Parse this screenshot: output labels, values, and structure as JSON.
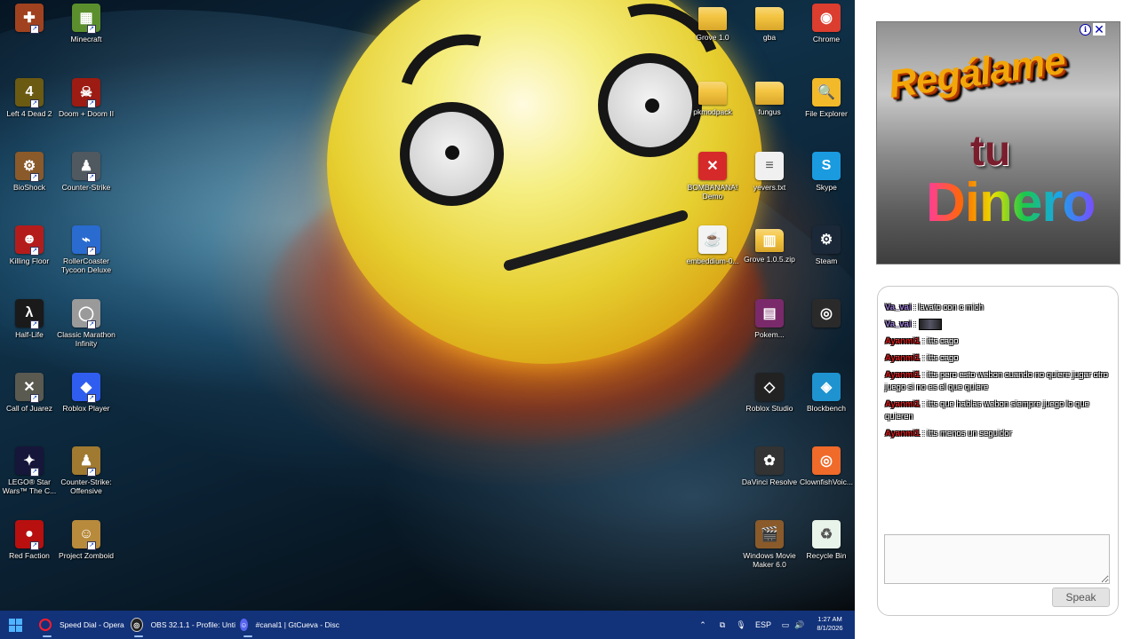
{
  "desktop": {
    "icons": [
      {
        "name": "Team Fortress",
        "label": "",
        "icon": "tf-icon",
        "color": "#a0421f",
        "glyph": "✚"
      },
      {
        "name": "Minecraft",
        "label": "Minecraft",
        "icon": "minecraft-icon",
        "color": "#5b8f2d",
        "glyph": "▦"
      },
      {
        "name": "Left 4 Dead 2",
        "label": "Left 4 Dead 2",
        "icon": "left4dead-icon",
        "color": "#6b5a12",
        "glyph": "4"
      },
      {
        "name": "Doom",
        "label": "Doom + Doom II",
        "icon": "doom-icon",
        "color": "#9c1b12",
        "glyph": "☠"
      },
      {
        "name": "BioShock",
        "label": "BioShock",
        "icon": "bioshock-icon",
        "color": "#8a5a2a",
        "glyph": "⚙"
      },
      {
        "name": "Counter-Strike",
        "label": "Counter-Strike",
        "icon": "counterstrike-icon",
        "color": "#505860",
        "glyph": "♟"
      },
      {
        "name": "Killing Floor",
        "label": "Killing Floor",
        "icon": "killingfloor-icon",
        "color": "#b41c1c",
        "glyph": "☻"
      },
      {
        "name": "RollerCoaster Tycoon Deluxe",
        "label": "RollerCoaster Tycoon Deluxe",
        "icon": "rollercoaster-icon",
        "color": "#2a6bd0",
        "glyph": "⌁"
      },
      {
        "name": "Half-Life",
        "label": "Half-Life",
        "icon": "halflife-icon",
        "color": "#1a1a1a",
        "glyph": "λ"
      },
      {
        "name": "Classic Marathon Infinity",
        "label": "Classic Marathon Infinity",
        "icon": "marathon-icon",
        "color": "#9a9a9a",
        "glyph": "◯"
      },
      {
        "name": "Call of Juarez",
        "label": "Call of Juarez",
        "icon": "callofjuarez-icon",
        "color": "#5a5a50",
        "glyph": "✕"
      },
      {
        "name": "Roblox Player",
        "label": "Roblox Player",
        "icon": "roblox-icon",
        "color": "#2f5df0",
        "glyph": "◆"
      },
      {
        "name": "LEGO Star Wars",
        "label": "LEGO® Star Wars™ The C...",
        "icon": "legostarwars-icon",
        "color": "#16163a",
        "glyph": "✦"
      },
      {
        "name": "Counter-Strike Offensive",
        "label": "Counter-Strike: Offensive",
        "icon": "csgo-icon",
        "color": "#a07a30",
        "glyph": "♟"
      },
      {
        "name": "Red Faction",
        "label": "Red Faction",
        "icon": "redfaction-icon",
        "color": "#b80f0f",
        "glyph": "●"
      },
      {
        "name": "Project Zomboid",
        "label": "Project Zomboid",
        "icon": "projectzomboid-icon",
        "color": "#b88a3c",
        "glyph": "☺"
      },
      {
        "name": "Grove Folder",
        "label": "Grove 1.0",
        "icon": "folder-icon",
        "color": "#f4c542",
        "glyph": ""
      },
      {
        "name": "gba",
        "label": "gba",
        "icon": "folder-icon",
        "color": "#f4c542",
        "glyph": ""
      },
      {
        "name": "Chrome",
        "label": "Chrome",
        "icon": "chrome-icon",
        "color": "#db3d2e",
        "glyph": "◉"
      },
      {
        "name": "pkmodpack",
        "label": "pkmodpack",
        "icon": "folder-icon",
        "color": "#f4c542",
        "glyph": ""
      },
      {
        "name": "fungus",
        "label": "fungus",
        "icon": "folder-icon",
        "color": "#f4c542",
        "glyph": ""
      },
      {
        "name": "File Explorer",
        "label": "File Explorer",
        "icon": "file-explorer-icon",
        "color": "#f2b92a",
        "glyph": "🔍"
      },
      {
        "name": "BOMBANANA",
        "label": "BOMBANANA! Demo",
        "icon": "bombanana-icon",
        "color": "#d62a2a",
        "glyph": "✕"
      },
      {
        "name": "yevers",
        "label": "yevers.txt",
        "icon": "text-file-icon",
        "color": "#f0f0f0",
        "glyph": "≡"
      },
      {
        "name": "Skype",
        "label": "Skype",
        "icon": "skype-icon",
        "color": "#1a9be0",
        "glyph": "S"
      },
      {
        "name": "embeddium",
        "label": "embeddium-0...",
        "icon": "java-icon",
        "color": "#f3f3f3",
        "glyph": "☕"
      },
      {
        "name": "Grove zip",
        "label": "Grove 1.0.5.zip",
        "icon": "zip-icon",
        "color": "#f4c542",
        "glyph": "▥"
      },
      {
        "name": "Steam",
        "label": "Steam",
        "icon": "steam-icon",
        "color": "#1b2838",
        "glyph": "⚙"
      },
      {
        "name": "WinRAR",
        "label": "Pokem...",
        "icon": "winrar-icon",
        "color": "#7a2a6a",
        "glyph": "▤"
      },
      {
        "name": "OBS",
        "label": "",
        "icon": "obs-icon",
        "color": "#2a2a2a",
        "glyph": "◎"
      },
      {
        "name": "Roblox Studio",
        "label": "Roblox Studio",
        "icon": "roblox-studio-icon",
        "color": "#222",
        "glyph": "◇"
      },
      {
        "name": "Blockbench",
        "label": "Blockbench",
        "icon": "blockbench-icon",
        "color": "#1e93d0",
        "glyph": "◈"
      },
      {
        "name": "DaVinci Resolve",
        "label": "DaVinci Resolve",
        "icon": "davinci-icon",
        "color": "#333",
        "glyph": "✿"
      },
      {
        "name": "ClownfishVoice",
        "label": "ClownfishVoic...",
        "icon": "clownfish-icon",
        "color": "#f06a2a",
        "glyph": "◎"
      },
      {
        "name": "Windows Movie Maker",
        "label": "Windows Movie Maker 6.0",
        "icon": "moviemaker-icon",
        "color": "#8a5a2a",
        "glyph": "🎬"
      },
      {
        "name": "Recycle Bin",
        "label": "Recycle Bin",
        "icon": "recycle-bin-icon",
        "color": "#e8f4ea",
        "glyph": "♻"
      }
    ]
  },
  "taskbar": {
    "items": [
      {
        "label": "Speed Dial - Opera",
        "icon": "opera-icon"
      },
      {
        "label": "OBS 32.1.1 - Profile: Unti",
        "icon": "obs-icon"
      },
      {
        "label": "#canal1 | GtCueva - Disc",
        "icon": "discord-icon"
      }
    ],
    "tray": {
      "language": "ESP",
      "time": "1:27 AM",
      "date": "8/1/2026"
    }
  },
  "ad": {
    "line1": "Regálame",
    "line2": "tu",
    "line3": "Dinero",
    "info_glyph": "i",
    "close_glyph": "✕"
  },
  "chat": {
    "messages": [
      {
        "user": "Va_vai",
        "user_color": "#9b7bd6",
        "text": "lavato con c mich"
      },
      {
        "user": "Va_vai",
        "user_color": "#9b7bd6",
        "text": "",
        "has_image": true
      },
      {
        "user": "Ayanmi1",
        "user_color": "#d51c1c",
        "text": "itts cago"
      },
      {
        "user": "Ayanmi1",
        "user_color": "#d51c1c",
        "text": "itts cago"
      },
      {
        "user": "Ayanmi1",
        "user_color": "#d51c1c",
        "text": "itts pero esto webon cuando no quiere jugar otro juego si no es el que quiere"
      },
      {
        "user": "Ayanmi1",
        "user_color": "#d51c1c",
        "text": "itts que hablas webon siempre juego lo que quieren"
      },
      {
        "user": "Ayanmi1",
        "user_color": "#d51c1c",
        "text": "itts menos un seguidor"
      }
    ],
    "input_value": "",
    "speak_label": "Speak"
  }
}
